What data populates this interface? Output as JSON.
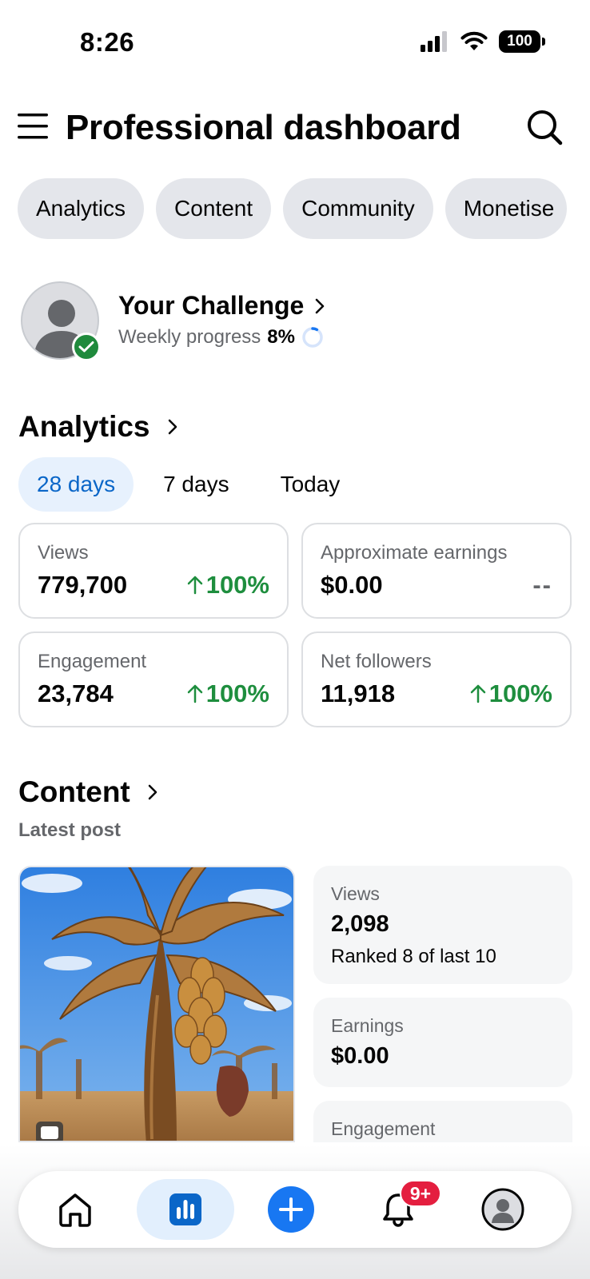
{
  "status_bar": {
    "time": "8:26",
    "battery": "100"
  },
  "header": {
    "title": "Professional dashboard"
  },
  "chips": [
    "Analytics",
    "Content",
    "Community",
    "Monetise"
  ],
  "challenge": {
    "title": "Your Challenge",
    "progress_label": "Weekly progress",
    "progress_value": "8%",
    "progress_fraction": 0.08
  },
  "analytics": {
    "title": "Analytics",
    "ranges": [
      "28 days",
      "7 days",
      "Today"
    ],
    "selected_range": "28 days",
    "cards": [
      {
        "label": "Views",
        "value": "779,700",
        "delta": "100%",
        "trend": "up"
      },
      {
        "label": "Approximate earnings",
        "value": "$0.00",
        "delta": "--",
        "trend": "none"
      },
      {
        "label": "Engagement",
        "value": "23,784",
        "delta": "100%",
        "trend": "up"
      },
      {
        "label": "Net followers",
        "value": "11,918",
        "delta": "100%",
        "trend": "up"
      }
    ]
  },
  "content": {
    "title": "Content",
    "subtitle": "Latest post",
    "metrics": [
      {
        "label": "Views",
        "value": "2,098",
        "note": "Ranked 8 of last 10"
      },
      {
        "label": "Earnings",
        "value": "$0.00"
      },
      {
        "label": "Engagement"
      }
    ]
  },
  "bottom_nav": {
    "items": [
      "home-icon",
      "stats-icon",
      "create-icon",
      "notifications-icon",
      "profile-icon"
    ],
    "active": "stats-icon",
    "notification_badge": "9+"
  },
  "colors": {
    "accent": "#0a66c8",
    "create_button": "#1877f2",
    "positive": "#1e8e3e",
    "badge": "#e41e3f",
    "chip_bg": "#e4e6eb",
    "verified": "#1f8a3c"
  }
}
